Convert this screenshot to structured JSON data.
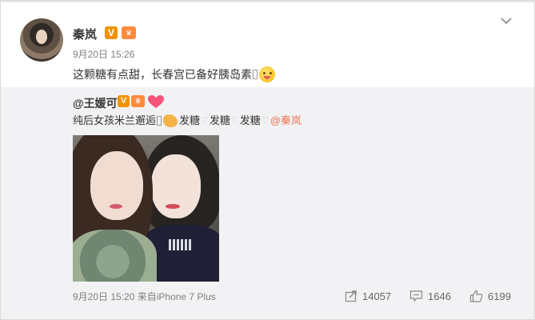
{
  "post": {
    "author": "秦岚",
    "verified_badge": "V",
    "vip_badge": "♛",
    "time": "9月20日 15:26",
    "content": "这颗糖有点甜，长春宫已备好胰岛素"
  },
  "repost": {
    "author": "@王媛可",
    "verified_badge": "V",
    "vip_badge": "♛",
    "text_prefix": "纯后女孩米兰邂逅",
    "tag1": "发糖",
    "tag2": "发糖",
    "tag3": "发糖",
    "mention": "@秦岚",
    "footer": "9月20日 15:20 来自iPhone 7 Plus",
    "stats": {
      "forwards": "14057",
      "comments": "1646",
      "likes": "6199"
    }
  },
  "icons": {
    "menu": "chevron-down-icon",
    "forward": "forward-icon",
    "comment": "comment-icon",
    "like": "thumbs-up-icon"
  },
  "colors": {
    "link": "#eb7350",
    "verified": "#f19300",
    "repost_bg": "#f2f2f5"
  }
}
